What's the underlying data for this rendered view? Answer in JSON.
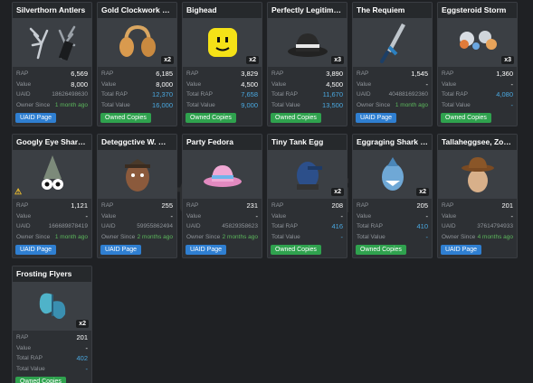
{
  "labels": {
    "rap": "RAP",
    "value": "Value",
    "uaid": "UAID",
    "owner_since": "Owner Since",
    "total_rap": "Total RAP",
    "total_value": "Total Value",
    "uaid_page": "UAID Page",
    "owned_copies": "Owned Copies"
  },
  "watermark": "itemsatis",
  "items": [
    {
      "name": "Silverthorn Antlers",
      "rap": "6,569",
      "value": "8,000",
      "uaid": "18626498630",
      "owner_since": "1 month ago",
      "icon": "antlers-icon",
      "button": "uaid"
    },
    {
      "name": "Gold Clockwork Headphones",
      "qty": "x2",
      "rap": "6,185",
      "value": "8,000",
      "total_rap": "12,370",
      "total_value": "16,000",
      "icon": "headphones-icon",
      "button": "owned"
    },
    {
      "name": "Bighead",
      "qty": "x2",
      "rap": "3,829",
      "value": "4,500",
      "total_rap": "7,658",
      "total_value": "9,000",
      "icon": "bighead-icon",
      "button": "owned"
    },
    {
      "name": "Perfectly Legitimate Business Hat",
      "qty": "x3",
      "rap": "3,890",
      "value": "4,500",
      "total_rap": "11,670",
      "total_value": "13,500",
      "icon": "fedora-icon",
      "button": "owned"
    },
    {
      "name": "The Requiem",
      "rap": "1,545",
      "value": "-",
      "uaid": "404881692360",
      "owner_since": "1 month ago",
      "icon": "sword-icon",
      "button": "uaid"
    },
    {
      "name": "Eggsteroid Storm",
      "qty": "x3",
      "rap": "1,360",
      "value": "-",
      "total_rap": "4,080",
      "total_value": "-",
      "icon": "egg-storm-icon",
      "button": "owned"
    },
    {
      "name": "Googly Eye Shark Hat",
      "warn": "⚠",
      "rap": "1,121",
      "value": "-",
      "uaid": "166689878419",
      "owner_since": "1 month ago",
      "icon": "shark-hat-icon",
      "button": "uaid"
    },
    {
      "name": "Deteggctive W. Wolf",
      "rap": "255",
      "value": "-",
      "uaid": "59955862494",
      "owner_since": "2 months ago",
      "icon": "wolf-egg-icon",
      "button": "uaid"
    },
    {
      "name": "Party Fedora",
      "rap": "231",
      "value": "-",
      "uaid": "45829358623",
      "owner_since": "2 months ago",
      "icon": "party-fedora-icon",
      "button": "uaid"
    },
    {
      "name": "Tiny Tank Egg",
      "qty": "x2",
      "rap": "208",
      "value": "-",
      "total_rap": "416",
      "total_value": "-",
      "icon": "tank-egg-icon",
      "button": "owned"
    },
    {
      "name": "Eggraging Shark of the Deep",
      "qty": "x2",
      "rap": "205",
      "value": "-",
      "total_rap": "410",
      "total_value": "-",
      "icon": "shark-egg-icon",
      "button": "owned"
    },
    {
      "name": "Tallaheggsee, Zombie Hunter",
      "rap": "201",
      "value": "-",
      "uaid": "37614794933",
      "owner_since": "4 months ago",
      "icon": "zombie-hunter-icon",
      "button": "uaid"
    },
    {
      "name": "Frosting Flyers",
      "qty": "x2",
      "rap": "201",
      "value": "-",
      "total_rap": "402",
      "total_value": "-",
      "icon": "wings-icon",
      "button": "owned"
    }
  ]
}
